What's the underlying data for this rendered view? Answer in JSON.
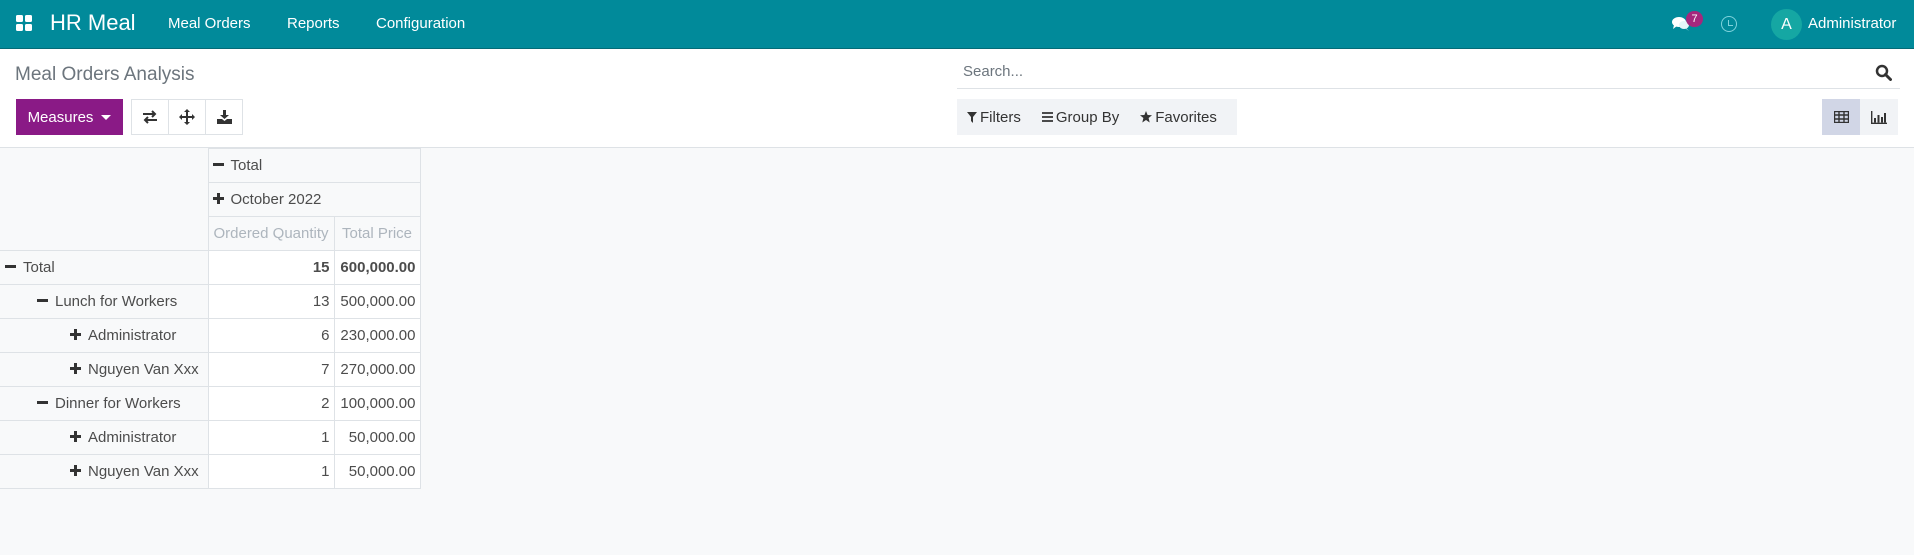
{
  "navbar": {
    "brand": "HR Meal",
    "menu": [
      {
        "label": "Meal Orders"
      },
      {
        "label": "Reports"
      },
      {
        "label": "Configuration"
      }
    ],
    "messages_badge": "7",
    "user": {
      "avatar_letter": "A",
      "name": "Administrator"
    },
    "colors": {
      "bar": "#018a9a",
      "badge": "#a5277d",
      "avatar": "#15a7a3"
    }
  },
  "control_panel": {
    "title": "Meal Orders Analysis",
    "measures_label": "Measures",
    "tool_buttons": [
      {
        "icon": "flip-axis-icon"
      },
      {
        "icon": "expand-all-icon"
      },
      {
        "icon": "download-icon"
      }
    ],
    "search": {
      "placeholder": "Search...",
      "value": ""
    },
    "filters_label": "Filters",
    "group_by_label": "Group By",
    "favorites_label": "Favorites",
    "views": [
      {
        "name": "pivot",
        "icon": "table-icon",
        "active": true
      },
      {
        "name": "graph",
        "icon": "bar-chart-icon",
        "active": false
      }
    ],
    "colors": {
      "measures_button": "#8a1a86"
    }
  },
  "pivot": {
    "col_header_total": "Total",
    "col_header_group": "October 2022",
    "measures": [
      "Ordered Quantity",
      "Total Price"
    ],
    "rows": [
      {
        "label": "Total",
        "level": 0,
        "expanded": true,
        "qty": "15",
        "price": "600,000.00",
        "bold": true
      },
      {
        "label": "Lunch for Workers",
        "level": 1,
        "expanded": true,
        "qty": "13",
        "price": "500,000.00"
      },
      {
        "label": "Administrator",
        "level": 2,
        "expanded": false,
        "qty": "6",
        "price": "230,000.00"
      },
      {
        "label": "Nguyen Van Xxx",
        "level": 2,
        "expanded": false,
        "qty": "7",
        "price": "270,000.00"
      },
      {
        "label": "Dinner for Workers",
        "level": 1,
        "expanded": true,
        "qty": "2",
        "price": "100,000.00"
      },
      {
        "label": "Administrator",
        "level": 2,
        "expanded": false,
        "qty": "1",
        "price": "50,000.00"
      },
      {
        "label": "Nguyen Van Xxx",
        "level": 2,
        "expanded": false,
        "qty": "1",
        "price": "50,000.00"
      }
    ]
  }
}
